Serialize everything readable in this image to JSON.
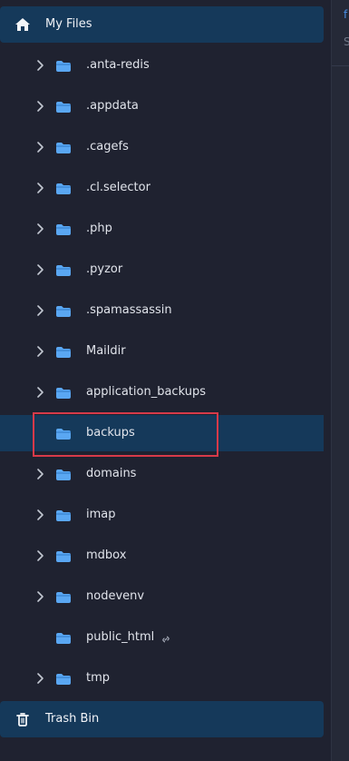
{
  "sidebar": {
    "my_files": {
      "label": "My Files",
      "icon": "home-icon"
    },
    "trash_bin": {
      "label": "Trash Bin",
      "icon": "trash-icon"
    },
    "items": [
      {
        "label": ".anta-redis",
        "has_chevron": true
      },
      {
        "label": ".appdata",
        "has_chevron": true
      },
      {
        "label": ".cagefs",
        "has_chevron": true
      },
      {
        "label": ".cl.selector",
        "has_chevron": true
      },
      {
        "label": ".php",
        "has_chevron": true
      },
      {
        "label": ".pyzor",
        "has_chevron": true
      },
      {
        "label": ".spamassassin",
        "has_chevron": true
      },
      {
        "label": "Maildir",
        "has_chevron": true
      },
      {
        "label": "application_backups",
        "has_chevron": true
      },
      {
        "label": "backups",
        "has_chevron": false,
        "selected": true
      },
      {
        "label": "domains",
        "has_chevron": true
      },
      {
        "label": "imap",
        "has_chevron": true
      },
      {
        "label": "mdbox",
        "has_chevron": true
      },
      {
        "label": "nodevenv",
        "has_chevron": true
      },
      {
        "label": "public_html",
        "has_chevron": false,
        "has_link_icon": true
      },
      {
        "label": "tmp",
        "has_chevron": true
      }
    ]
  },
  "right_panel": {
    "top_glyph": "f",
    "second_glyph": "S"
  },
  "colors": {
    "background": "#1f2230",
    "selection": "#15395a",
    "folder": "#5aa7f2",
    "highlight": "#d73a49"
  }
}
